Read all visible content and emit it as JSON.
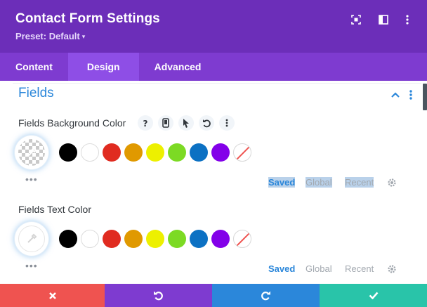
{
  "header": {
    "title": "Contact Form Settings",
    "preset": "Preset: Default",
    "caret": "▾"
  },
  "tabs": [
    {
      "label": "Content"
    },
    {
      "label": "Design"
    },
    {
      "label": "Advanced"
    }
  ],
  "section": {
    "title": "Fields"
  },
  "fields": [
    {
      "label": "Fields Background Color",
      "palette": {
        "saved": "Saved",
        "global": "Global",
        "recent": "Recent"
      }
    },
    {
      "label": "Fields Text Color",
      "palette": {
        "saved": "Saved",
        "global": "Global",
        "recent": "Recent"
      }
    }
  ],
  "swatches": [
    "#000000",
    "#ffffff",
    "#e02b20",
    "#e09900",
    "#edf000",
    "#7cda24",
    "#0c71c3",
    "#8300e9"
  ],
  "more_dots": "•••",
  "colors": {
    "header_bg": "#6c2eb9",
    "tabs_bg": "#7e3bd0",
    "active_tab_bg": "#8e4ee6",
    "accent_blue": "#2b87da",
    "cancel": "#ef5350",
    "undo": "#7e3bd0",
    "redo": "#2b87da",
    "save": "#29c4a9"
  }
}
